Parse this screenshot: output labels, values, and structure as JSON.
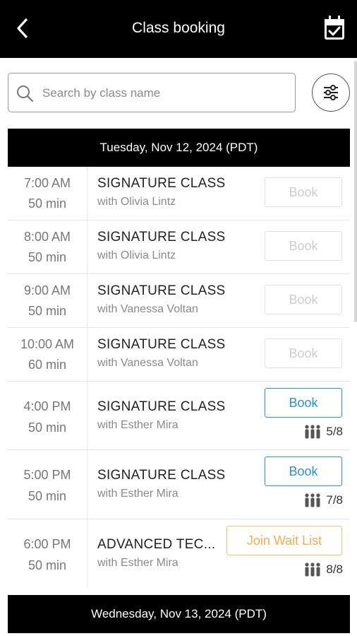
{
  "header": {
    "title": "Class booking"
  },
  "search": {
    "placeholder": "Search by class name"
  },
  "days": [
    {
      "label": "Tuesday, Nov 12, 2024 (PDT)"
    },
    {
      "label": "Wednesday, Nov 13, 2024 (PDT)"
    }
  ],
  "classes": [
    {
      "time": "7:00  AM",
      "duration": "50 min",
      "name": "SIGNATURE CLASS",
      "instructor": "with Olivia Lintz",
      "button": "Book",
      "state": "disabled",
      "capacity": ""
    },
    {
      "time": "8:00  AM",
      "duration": "50 min",
      "name": "SIGNATURE CLASS",
      "instructor": "with Olivia Lintz",
      "button": "Book",
      "state": "disabled",
      "capacity": ""
    },
    {
      "time": "9:00  AM",
      "duration": "50 min",
      "name": "SIGNATURE CLASS",
      "instructor": "with Vanessa Voltan",
      "button": "Book",
      "state": "disabled",
      "capacity": ""
    },
    {
      "time": "10:00  AM",
      "duration": "60 min",
      "name": "SIGNATURE CLASS",
      "instructor": "with Vanessa Voltan",
      "button": "Book",
      "state": "disabled",
      "capacity": ""
    },
    {
      "time": "4:00  PM",
      "duration": "50 min",
      "name": "SIGNATURE CLASS",
      "instructor": "with Esther Mira",
      "button": "Book",
      "state": "active",
      "capacity": "5/8"
    },
    {
      "time": "5:00  PM",
      "duration": "50 min",
      "name": "SIGNATURE CLASS",
      "instructor": "with Esther Mira",
      "button": "Book",
      "state": "active",
      "capacity": "7/8"
    },
    {
      "time": "6:00  PM",
      "duration": "50 min",
      "name": "ADVANCED TEC...",
      "instructor": "with Esther Mira",
      "button": "Join Wait List",
      "state": "wait",
      "capacity": "8/8"
    }
  ],
  "colors": {
    "header_bg": "#000000",
    "book_active": "#2b8fd6",
    "wait_list": "#f0ad4e",
    "disabled": "#cdcdcd"
  },
  "icons": {
    "back": "chevron-left-icon",
    "calendar": "calendar-check-icon",
    "search": "search-icon",
    "filter": "sliders-icon",
    "capacity": "people-icon"
  }
}
